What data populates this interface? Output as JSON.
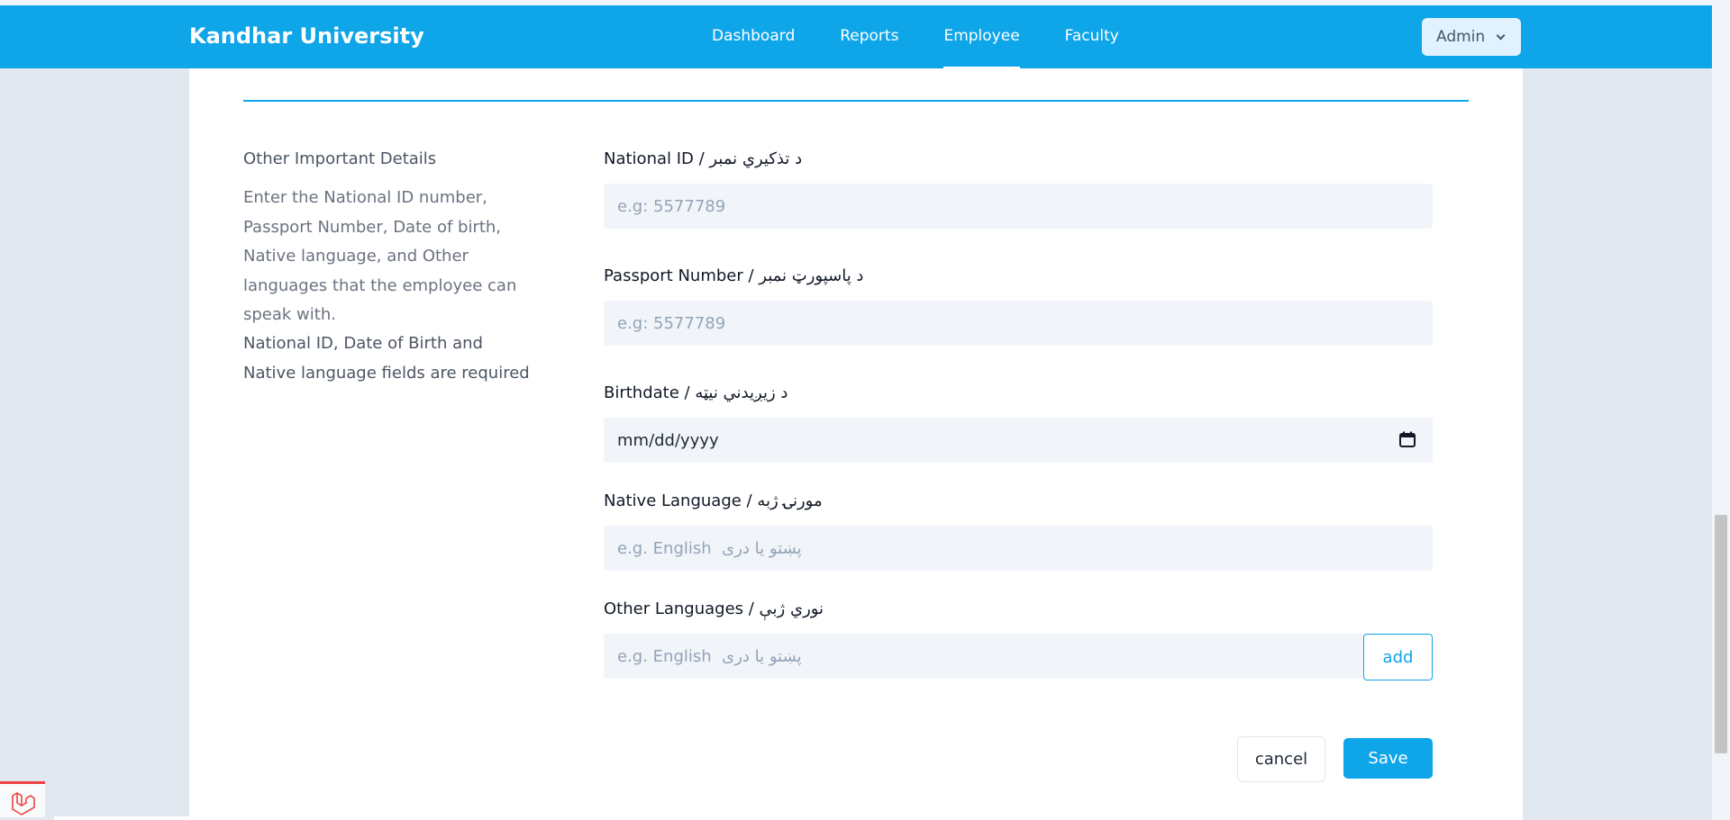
{
  "header": {
    "brand": "Kandhar University",
    "nav": [
      "Dashboard",
      "Reports",
      "Employee",
      "Faculty"
    ],
    "active_nav": "Employee",
    "user_menu": "Admin"
  },
  "section": {
    "title": "Other Important Details",
    "description": "Enter the National ID number, Passport Number, Date of birth, Native language, and Other languages that the employee can speak with.",
    "required_note": "National ID, Date of Birth and Native language fields are required"
  },
  "fields": {
    "national_id": {
      "label": "National ID / د تذکيري نمبر",
      "placeholder": "e.g: 5577789"
    },
    "passport": {
      "label": "Passport Number / د پاسپورټ نمبر",
      "placeholder": "e.g: 5577789"
    },
    "birthdate": {
      "label": "Birthdate / د زيږيدني نيټه",
      "value": "mm/dd/yyyy"
    },
    "native_language": {
      "label": "Native Language / مورنۍ ژبه",
      "placeholder": "e.g. English  پښتو یا دری"
    },
    "other_languages": {
      "label": "Other Languages / نوري ژبې",
      "placeholder": "e.g. English  پښتو یا دری",
      "add_label": "add"
    }
  },
  "actions": {
    "cancel": "cancel",
    "save": "Save"
  },
  "colors": {
    "primary": "#0ea5e9",
    "input_bg": "#f1f5f9"
  }
}
